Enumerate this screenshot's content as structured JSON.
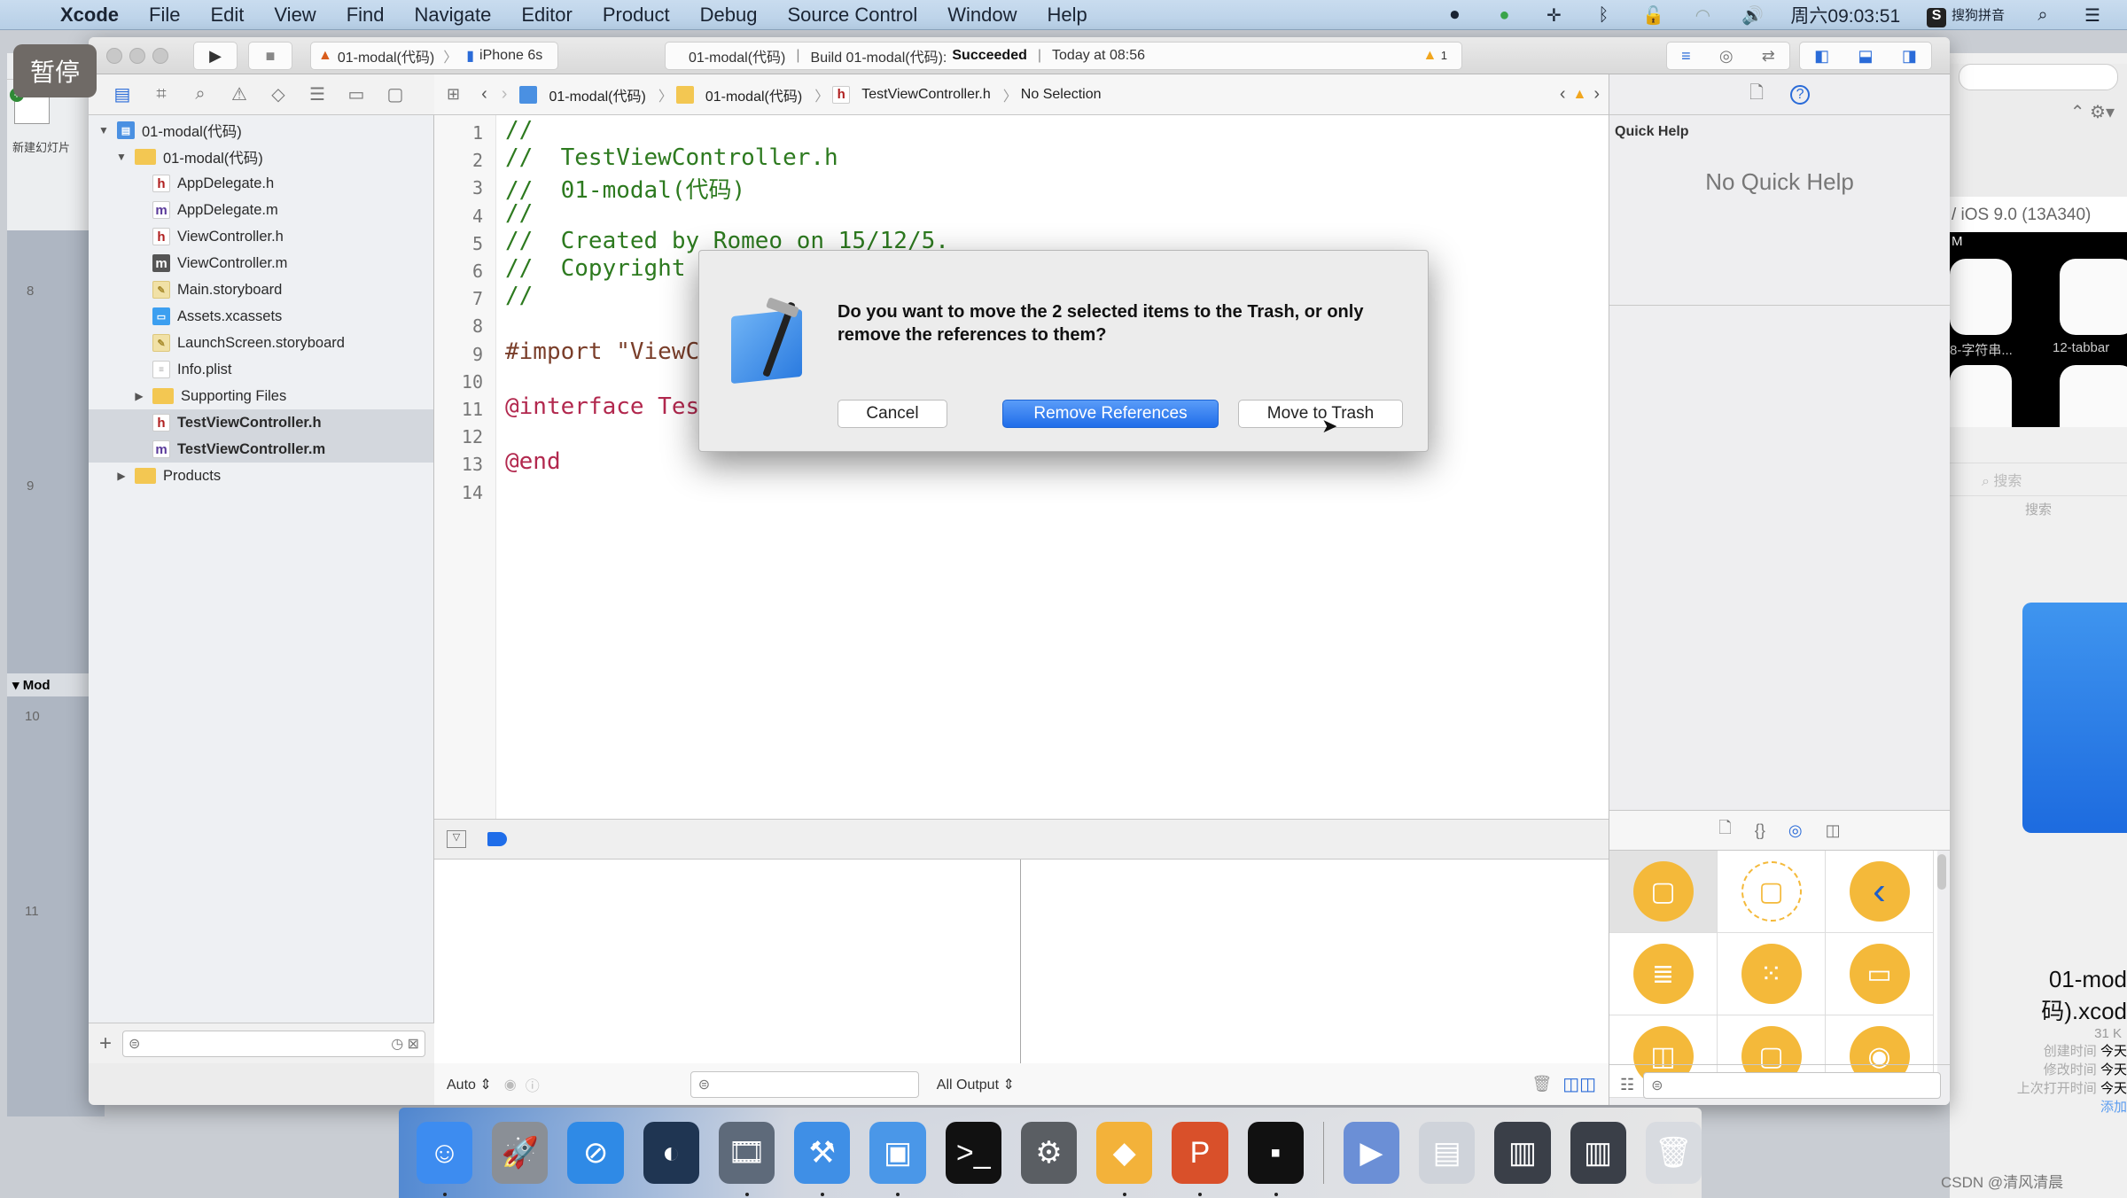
{
  "menubar": {
    "app": "Xcode",
    "items": [
      "File",
      "Edit",
      "View",
      "Find",
      "Navigate",
      "Editor",
      "Product",
      "Debug",
      "Source Control",
      "Window",
      "Help"
    ],
    "clock": "周六09:03:51",
    "input_method": "搜狗拼音",
    "tray_icons": [
      "screen-record-icon",
      "media-play-icon",
      "plus-move-icon",
      "bluetooth-icon",
      "lock-icon",
      "wifi-icon",
      "volume-icon"
    ]
  },
  "overlay": {
    "pause_label": "暂停"
  },
  "left_bg_window": {
    "new_slide_label": "新建幻灯片",
    "slide_numbers": [
      "8",
      "9",
      "10",
      "11"
    ],
    "section_label": "Mod"
  },
  "toolbar": {
    "scheme": "01-modal(代码)",
    "device": "iPhone 6s",
    "activity": {
      "project": "01-modal(代码)",
      "build_prefix": "Build 01-modal(代码):",
      "build_status": "Succeeded",
      "time": "Today at 08:56",
      "warning_count": "1"
    }
  },
  "jumpbar": {
    "crumbs": [
      "01-modal(代码)",
      "01-modal(代码)",
      "TestViewController.h",
      "No Selection"
    ]
  },
  "navigator": {
    "tree": [
      {
        "label": "01-modal(代码)",
        "type": "proj",
        "level": 0,
        "disclosure": "open"
      },
      {
        "label": "01-modal(代码)",
        "type": "folder",
        "level": 1,
        "disclosure": "open"
      },
      {
        "label": "AppDelegate.h",
        "type": "h",
        "level": 2
      },
      {
        "label": "AppDelegate.m",
        "type": "m",
        "level": 2
      },
      {
        "label": "ViewController.h",
        "type": "h",
        "level": 2
      },
      {
        "label": "ViewController.m",
        "type": "mdark",
        "level": 2
      },
      {
        "label": "Main.storyboard",
        "type": "sb",
        "level": 2
      },
      {
        "label": "Assets.xcassets",
        "type": "xc",
        "level": 2
      },
      {
        "label": "LaunchScreen.storyboard",
        "type": "sb",
        "level": 2
      },
      {
        "label": "Info.plist",
        "type": "pl",
        "level": 2
      },
      {
        "label": "Supporting Files",
        "type": "folder",
        "level": 2,
        "disclosure": "closed"
      },
      {
        "label": "TestViewController.h",
        "type": "h",
        "level": 2,
        "selected": true
      },
      {
        "label": "TestViewController.m",
        "type": "m",
        "level": 2,
        "selected": true
      },
      {
        "label": "Products",
        "type": "folder",
        "level": 1,
        "disclosure": "closed"
      }
    ]
  },
  "editor": {
    "lines": [
      {
        "n": "1",
        "t": "//",
        "c": "com"
      },
      {
        "n": "2",
        "t": "//  TestViewController.h",
        "c": "com"
      },
      {
        "n": "3",
        "t": "//  01-modal(代码)",
        "c": "com"
      },
      {
        "n": "4",
        "t": "//",
        "c": "com"
      },
      {
        "n": "5",
        "t": "//  Created by Romeo on 15/12/5.",
        "c": "com"
      },
      {
        "n": "6",
        "t": "//  Copyright",
        "c": "com"
      },
      {
        "n": "7",
        "t": "//",
        "c": "com"
      },
      {
        "n": "8",
        "t": "",
        "c": "tx"
      },
      {
        "n": "9",
        "t": "#import \"ViewC",
        "c": "pp"
      },
      {
        "n": "10",
        "t": "",
        "c": "tx"
      },
      {
        "n": "11",
        "t": "@interface Tes",
        "c": "kw"
      },
      {
        "n": "12",
        "t": "",
        "c": "tx"
      },
      {
        "n": "13",
        "t": "@end",
        "c": "kw"
      },
      {
        "n": "14",
        "t": "",
        "c": "tx"
      }
    ]
  },
  "debug": {
    "vars_mode": "Auto",
    "console_mode": "All Output"
  },
  "inspector": {
    "quick_help_title": "Quick Help",
    "quick_help_empty": "No Quick Help",
    "library_items": [
      "view-controller",
      "storyboard-reference",
      "navigation-controller",
      "table-view-controller",
      "collection-view-controller",
      "tab-bar-controller",
      "split-view-controller",
      "page-view-controller",
      "glkit-view-controller"
    ]
  },
  "dialog": {
    "message": "Do you want to move the 2 selected items to the Trash, or only remove the references to them?",
    "cancel": "Cancel",
    "remove_references": "Remove References",
    "move_to_trash": "Move to Trash"
  },
  "right_bg_window": {
    "ios_version": "/ iOS 9.0 (13A340)",
    "time_partial": "M",
    "apps": [
      "8-字符串...",
      "12-tabbar"
    ],
    "search_placeholder": "搜索",
    "search_label": "搜索",
    "file_name_line1": "01-mod",
    "file_name_line2": "码).xcod",
    "file_size": "31 K",
    "info": [
      {
        "k": "创建时间",
        "v": "今天"
      },
      {
        "k": "修改时间",
        "v": "今天"
      },
      {
        "k": "上次打开时间",
        "v": "今天"
      }
    ],
    "add_tag": "添加"
  },
  "dock": {
    "apps": [
      {
        "name": "finder",
        "color": "#3d8cf0",
        "glyph": "☺",
        "running": true
      },
      {
        "name": "launchpad",
        "color": "#8a8f96",
        "glyph": "🚀",
        "running": false
      },
      {
        "name": "safari",
        "color": "#2f8ae6",
        "glyph": "⊘",
        "running": false
      },
      {
        "name": "mouse-app",
        "color": "#1f3552",
        "glyph": "◐",
        "running": false
      },
      {
        "name": "imovie",
        "color": "#5e6a7a",
        "glyph": "🎞",
        "running": true
      },
      {
        "name": "xcode",
        "color": "#3f8fe6",
        "glyph": "⚒",
        "running": true
      },
      {
        "name": "simulator",
        "color": "#4a97e8",
        "glyph": "▣",
        "running": true
      },
      {
        "name": "terminal",
        "color": "#111111",
        "glyph": ">_",
        "running": false
      },
      {
        "name": "system-preferences",
        "color": "#5a5e63",
        "glyph": "⚙",
        "running": false
      },
      {
        "name": "sketch",
        "color": "#f3b23a",
        "glyph": "◆",
        "running": true
      },
      {
        "name": "powerpoint",
        "color": "#d9502a",
        "glyph": "P",
        "running": true
      },
      {
        "name": "console",
        "color": "#111111",
        "glyph": "▪",
        "running": true
      },
      {
        "name": "preview-media",
        "color": "#6b8fd6",
        "glyph": "▶",
        "running": false
      },
      {
        "name": "document-stack",
        "color": "#cfd3da",
        "glyph": "▤",
        "running": false
      },
      {
        "name": "screenshot-1",
        "color": "#3a3f48",
        "glyph": "▥",
        "running": false
      },
      {
        "name": "screenshot-2",
        "color": "#3a3f48",
        "glyph": "▥",
        "running": false
      },
      {
        "name": "trash",
        "color": "#d8dbe0",
        "glyph": "🗑",
        "running": false
      }
    ]
  },
  "watermark": "CSDN @清风清晨",
  "colors": {
    "accent": "#2a6bd8",
    "warning": "#f1a61e",
    "library_yellow": "#f4b93a"
  }
}
